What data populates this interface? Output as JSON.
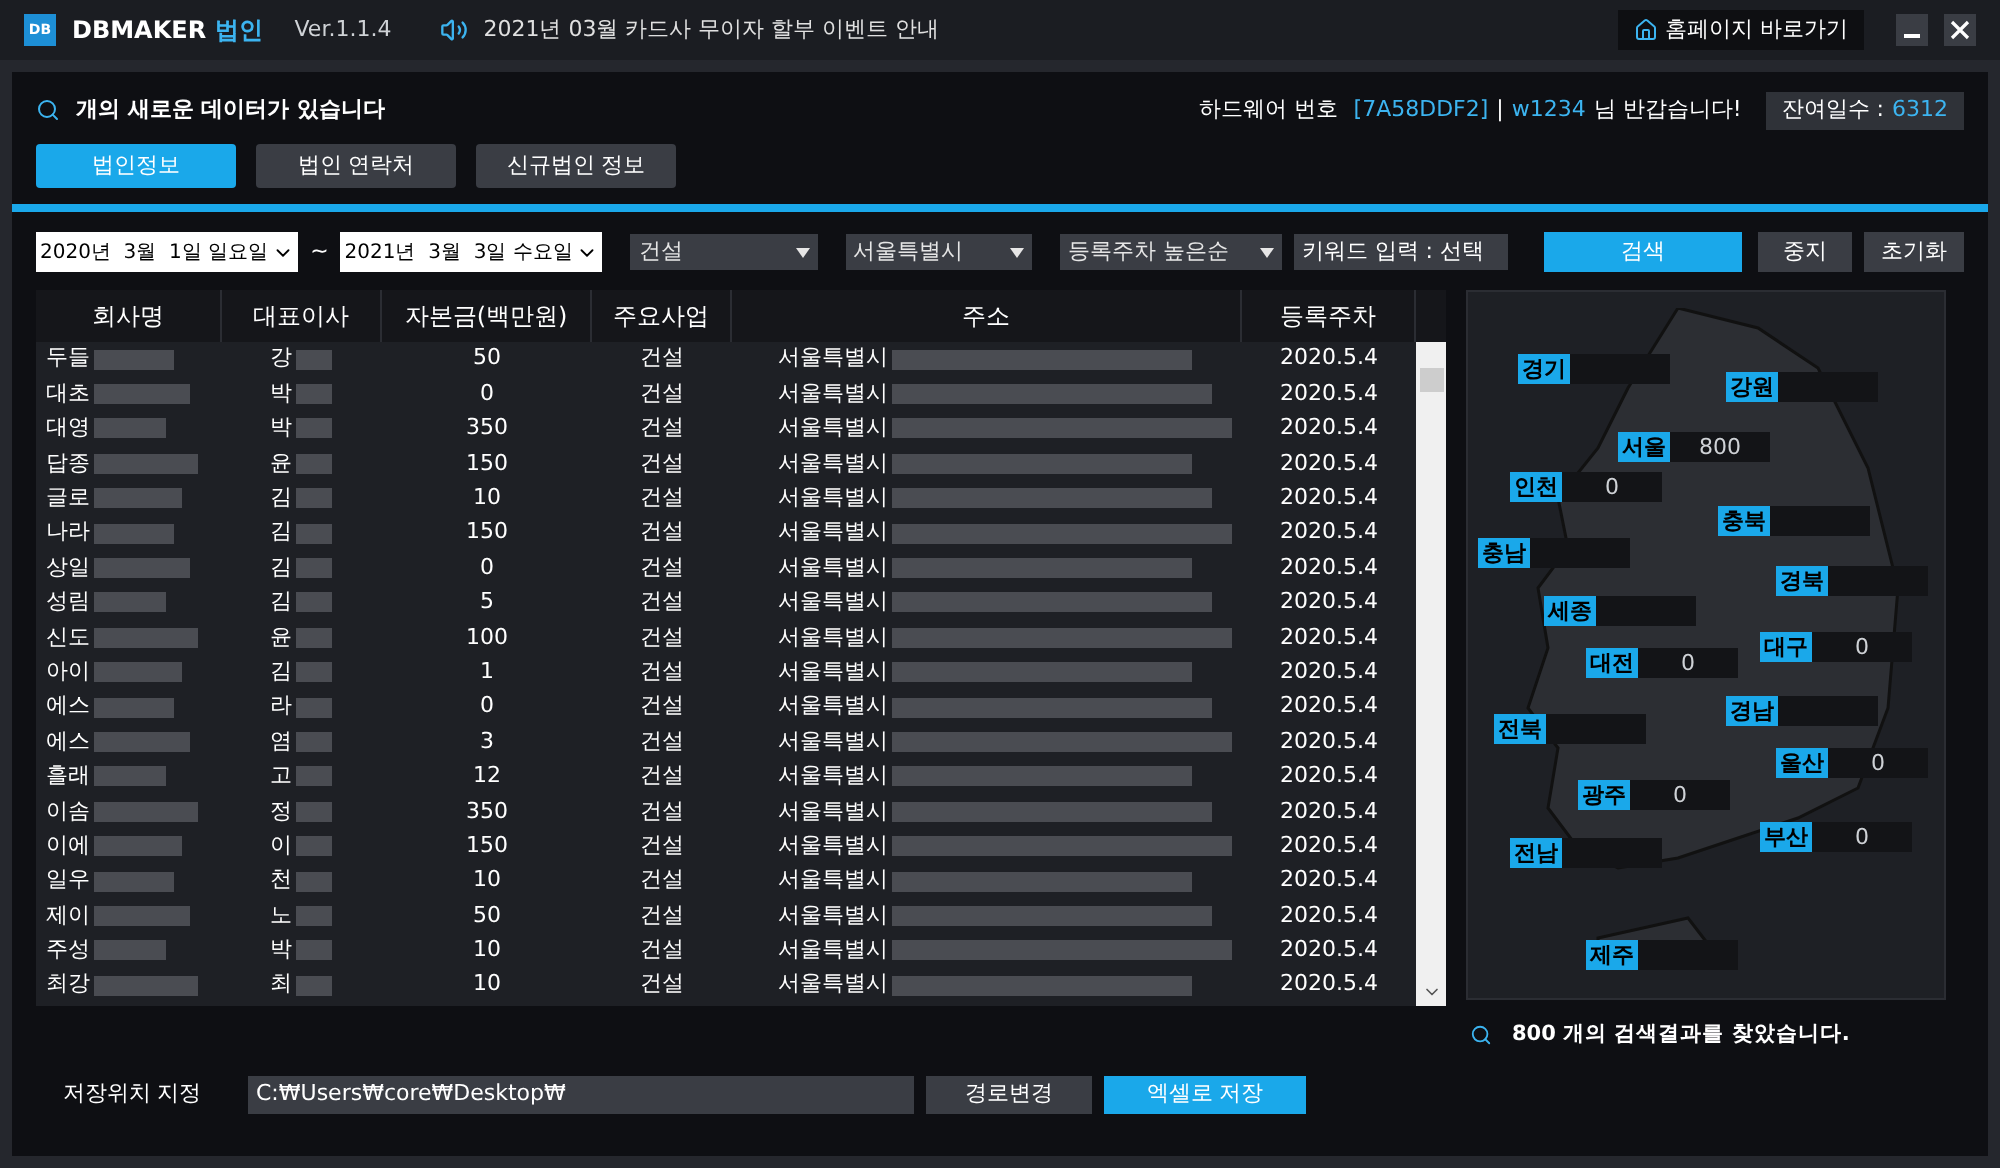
{
  "titlebar": {
    "logo": "DB",
    "brand": "DBMAKER",
    "brand_suffix": "법인",
    "version": "Ver.1.1.4",
    "notice": "2021년 03월 카드사 무이자 할부 이벤트 안내",
    "home_button": "홈페이지 바로가기"
  },
  "info": {
    "message": "개의 새로운 데이터가 있습니다",
    "hw_label": "하드웨어 번호",
    "hw_id": "[7A58DDF2]",
    "separator": "|",
    "user": "w1234",
    "greeting": "님 반갑습니다!",
    "days_label": "잔여일수 :",
    "days": "6312"
  },
  "tabs": [
    {
      "label": "법인정보",
      "selected": true
    },
    {
      "label": "법인 연락처",
      "selected": false
    },
    {
      "label": "신규법인 정보",
      "selected": false
    }
  ],
  "filters": {
    "date_from": "2020년  3월  1일 일요일",
    "tilde": "~",
    "date_to": "2021년  3월  3일 수요일",
    "industry": "건설",
    "region": "서울특별시",
    "sort": "등록주차 높은순",
    "keyword": "키워드 입력 : 선택",
    "search": "검색",
    "stop": "중지",
    "reset": "초기화"
  },
  "table": {
    "columns": [
      "회사명",
      "대표이사",
      "자본금(백만원)",
      "주요사업",
      "주소",
      "등록주차"
    ],
    "rows": [
      {
        "name": "두들",
        "ceo": "강",
        "capital": "50",
        "business": "건설",
        "address": "서울특별시",
        "date": "2020.5.4"
      },
      {
        "name": "대초",
        "ceo": "박",
        "capital": "0",
        "business": "건설",
        "address": "서울특별시",
        "date": "2020.5.4"
      },
      {
        "name": "대영",
        "ceo": "박",
        "capital": "350",
        "business": "건설",
        "address": "서울특별시",
        "date": "2020.5.4"
      },
      {
        "name": "답종",
        "ceo": "윤",
        "capital": "150",
        "business": "건설",
        "address": "서울특별시",
        "date": "2020.5.4"
      },
      {
        "name": "글로",
        "ceo": "김",
        "capital": "10",
        "business": "건설",
        "address": "서울특별시",
        "date": "2020.5.4"
      },
      {
        "name": "나라",
        "ceo": "김",
        "capital": "150",
        "business": "건설",
        "address": "서울특별시",
        "date": "2020.5.4"
      },
      {
        "name": "상일",
        "ceo": "김",
        "capital": "0",
        "business": "건설",
        "address": "서울특별시",
        "date": "2020.5.4"
      },
      {
        "name": "성림",
        "ceo": "김",
        "capital": "5",
        "business": "건설",
        "address": "서울특별시",
        "date": "2020.5.4"
      },
      {
        "name": "신도",
        "ceo": "윤",
        "capital": "100",
        "business": "건설",
        "address": "서울특별시",
        "date": "2020.5.4"
      },
      {
        "name": "아이",
        "ceo": "김",
        "capital": "1",
        "business": "건설",
        "address": "서울특별시",
        "date": "2020.5.4"
      },
      {
        "name": "에스",
        "ceo": "라",
        "capital": "0",
        "business": "건설",
        "address": "서울특별시",
        "date": "2020.5.4"
      },
      {
        "name": "에스",
        "ceo": "염",
        "capital": "3",
        "business": "건설",
        "address": "서울특별시",
        "date": "2020.5.4"
      },
      {
        "name": "흘래",
        "ceo": "고",
        "capital": "12",
        "business": "건설",
        "address": "서울특별시",
        "date": "2020.5.4"
      },
      {
        "name": "이솜",
        "ceo": "정",
        "capital": "350",
        "business": "건설",
        "address": "서울특별시",
        "date": "2020.5.4"
      },
      {
        "name": "이에",
        "ceo": "이",
        "capital": "150",
        "business": "건설",
        "address": "서울특별시",
        "date": "2020.5.4"
      },
      {
        "name": "일우",
        "ceo": "천",
        "capital": "10",
        "business": "건설",
        "address": "서울특별시",
        "date": "2020.5.4"
      },
      {
        "name": "제이",
        "ceo": "노",
        "capital": "50",
        "business": "건설",
        "address": "서울특별시",
        "date": "2020.5.4"
      },
      {
        "name": "주성",
        "ceo": "박",
        "capital": "10",
        "business": "건설",
        "address": "서울특별시",
        "date": "2020.5.4"
      },
      {
        "name": "최강",
        "ceo": "최",
        "capital": "10",
        "business": "건설",
        "address": "서울특별시",
        "date": "2020.5.4"
      }
    ]
  },
  "map": {
    "regions": [
      {
        "name": "경기"
      },
      {
        "name": "강원"
      },
      {
        "name": "서울",
        "value": "800"
      },
      {
        "name": "인천",
        "value": "0"
      },
      {
        "name": "충북"
      },
      {
        "name": "충남"
      },
      {
        "name": "경북"
      },
      {
        "name": "세종"
      },
      {
        "name": "대전",
        "value": "0"
      },
      {
        "name": "대구",
        "value": "0"
      },
      {
        "name": "경남"
      },
      {
        "name": "전북"
      },
      {
        "name": "울산",
        "value": "0"
      },
      {
        "name": "광주",
        "value": "0"
      },
      {
        "name": "부산",
        "value": "0"
      },
      {
        "name": "전남"
      },
      {
        "name": "제주"
      }
    ],
    "result": "800 개의 검색결과를 찾았습니다."
  },
  "save": {
    "label": "저장위치 지정",
    "path": "C:₩Users₩core₩Desktop₩",
    "change": "경로변경",
    "excel": "엑셀로 저장"
  }
}
